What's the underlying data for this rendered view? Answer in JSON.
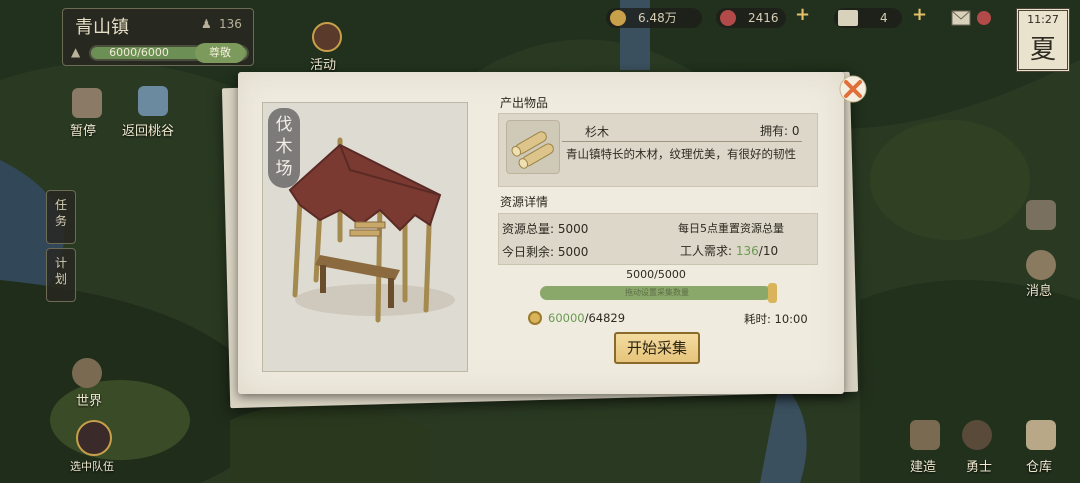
{
  "hud": {
    "town_name": "青山镇",
    "population": "136",
    "hp_text": "6000/6000",
    "hp_progress": 1.0,
    "rank_label": "尊敬",
    "resources": [
      {
        "icon": "copper-coin-icon",
        "value": "6.48万",
        "color": "#c9a04a"
      },
      {
        "icon": "gem-icon",
        "value": "2416",
        "color": "#b14a48"
      },
      {
        "icon": "ticket-icon",
        "value": "4",
        "color": "#d8d2bc"
      }
    ],
    "time": "11:27",
    "season": "夏"
  },
  "nav": {
    "activity": "活动",
    "pause": "暂停",
    "return": "返回桃谷",
    "task": "任务",
    "plan": "计划",
    "world": "世界",
    "selected_team": "选中队伍",
    "message": "消息",
    "build": "建造",
    "warrior": "勇士",
    "warehouse": "仓库"
  },
  "modal": {
    "building_name": "伐木场",
    "output_title": "产出物品",
    "item": {
      "name": "杉木",
      "owned": "拥有: 0",
      "description": "青山镇特长的木材，纹理优美，有很好的韧性"
    },
    "resource_title": "资源详情",
    "total_label": "资源总量: 5000",
    "reset_note": "每日5点重置资源总量",
    "remaining_label": "今日剩余: 5000",
    "workers_label": "工人需求:",
    "workers_current": "136",
    "workers_required": "/10",
    "progress_text": "5000/5000",
    "progress": 1.0,
    "progress_inner": "拖动设置采集数量",
    "cost_current": "60000",
    "cost_total": "/64829",
    "time_cost": "耗时: 10:00",
    "start_button": "开始采集"
  },
  "colors": {
    "accent": "#e6c47a",
    "green": "#6b9a52",
    "close": "#e0703a"
  }
}
